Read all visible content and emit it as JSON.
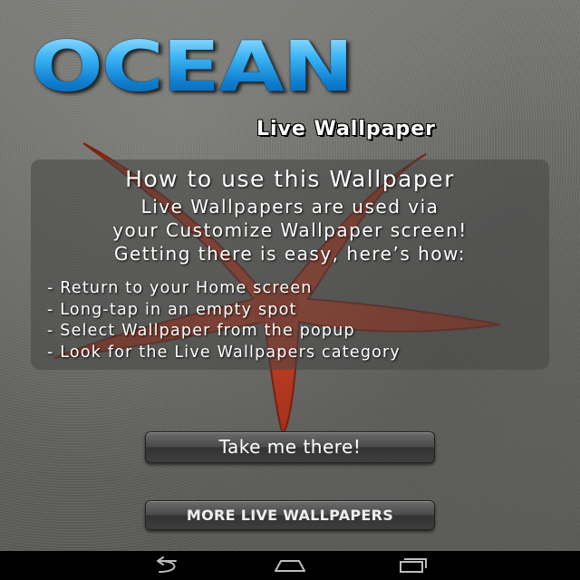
{
  "logo": {
    "title": "OCEAN",
    "subtitle": "Live Wallpaper"
  },
  "instructions": {
    "heading": "How to use this Wallpaper",
    "intro": [
      "Live Wallpapers are used via",
      "your Customize Wallpaper screen!",
      "Getting there is easy, here’s  how:"
    ],
    "steps": [
      "- Return to your Home screen",
      "- Long-tap in an empty spot",
      "- Select Wallpaper from the popup",
      "- Look for the Live Wallpapers category"
    ]
  },
  "buttons": {
    "primary_label": "Take me there!",
    "secondary_label": "MORE LIVE WALLPAPERS"
  },
  "navbar": {
    "icons": [
      "back-icon",
      "home-icon",
      "recent-apps-icon"
    ]
  },
  "colors": {
    "logo_blue": "#1a9fe8",
    "starfish_red": "#b83a22",
    "navbar": "#000000"
  }
}
